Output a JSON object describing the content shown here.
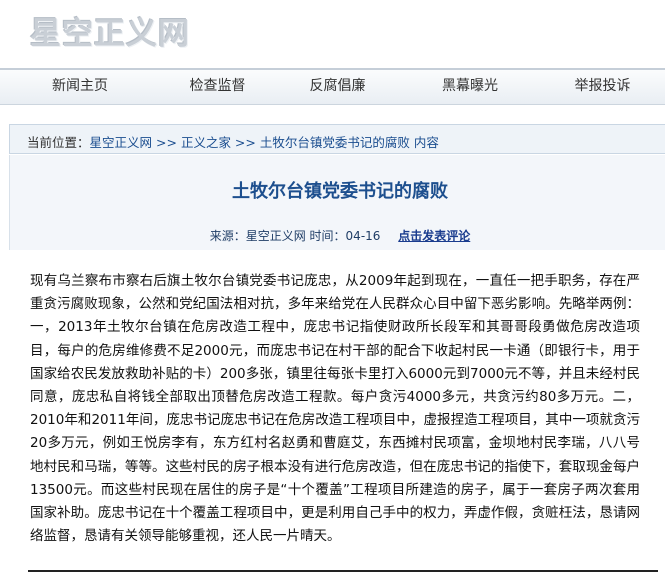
{
  "site": {
    "logo_text": "星空正义网"
  },
  "nav": {
    "items": [
      "新闻主页",
      "检查监督",
      "反腐倡廉",
      "黑幕曝光",
      "举报投诉"
    ]
  },
  "breadcrumb": {
    "label": "当前位置：",
    "home": "星空正义网",
    "sep1": " >> ",
    "section": "正义之家",
    "sep2": " >> ",
    "current": "土牧尔台镇党委书记的腐败 内容"
  },
  "article": {
    "title": "土牧尔台镇党委书记的腐败",
    "meta": "来源：星空正义网 时间：04-16",
    "comment_link": "点击发表评论",
    "body": "现有乌兰察布市察右后旗土牧尔台镇党委书记庞忠，从2009年起到现在，一直任一把手职务，存在严重贪污腐败现象，公然和党纪国法相对抗，多年来给党在人民群众心目中留下恶劣影响。先略举两例：一，2013年土牧尔台镇在危房改造工程中，庞忠书记指使财政所长段军和其哥哥段勇做危房改造项目，每户的危房维修费不足2000元，而庞忠书记在村干部的配合下收起村民一卡通（即银行卡，用于国家给农民发放救助补贴的卡）200多张，镇里往每张卡里打入6000元到7000元不等，并且未经村民同意，庞忠私自将钱全部取出顶替危房改造工程款。每户贪污4000多元，共贪污约80多万元。二，2010年和2011年间，庞忠书记庞忠书记在危房改造工程项目中，虚报捏造工程项目，其中一项就贪污20多万元，例如王悦房李有，东方红村名赵勇和曹庭艾，东西摊村民项富，金坝地村民李瑞，八八号地村民和马瑞，等等。这些村民的房子根本没有进行危房改造，但在庞忠书记的指使下，套取现金每户13500元。而这些村民现在居住的房子是“十个覆盖”工程项目所建造的房子，属于一套房子两次套用国家补助。庞忠书记在十个覆盖工程项目中，更是利用自己手中的权力，弄虚作假，贪赃枉法，恳请网络监督，恳请有关领导能够重视，还人民一片晴天。"
  }
}
